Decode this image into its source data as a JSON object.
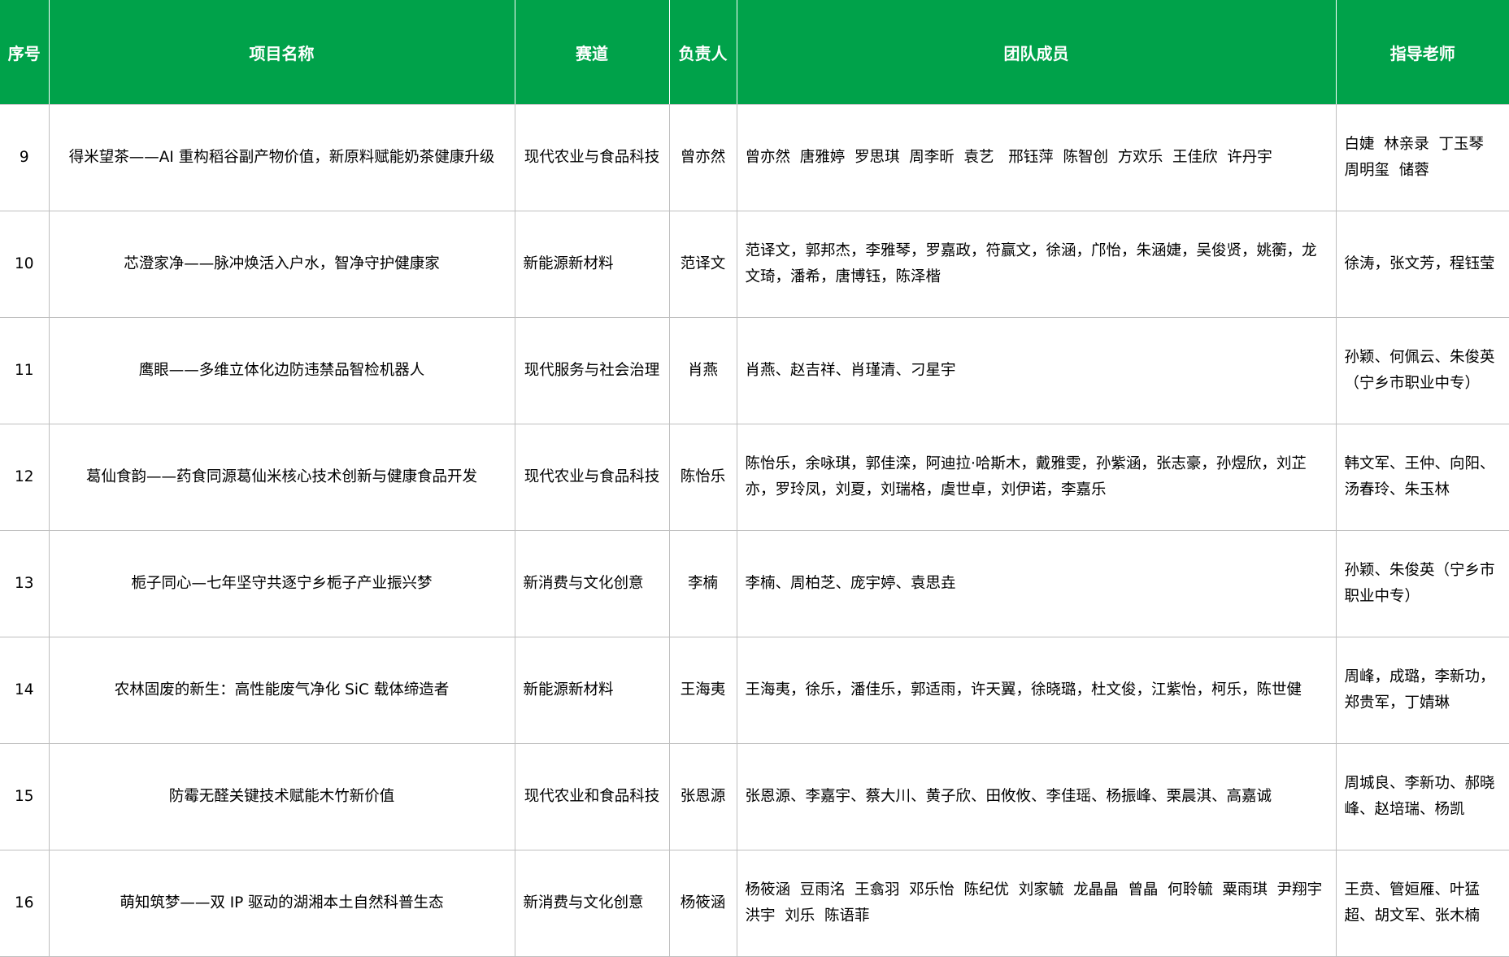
{
  "header": {
    "seq": "序号",
    "name": "项目名称",
    "track": "赛道",
    "leader": "负责人",
    "team": "团队成员",
    "advisor": "指导老师"
  },
  "rows": [
    {
      "seq": "9",
      "name": "得米望茶——AI 重构稻谷副产物价值，新原料赋能奶茶健康升级",
      "track": "现代农业与食品科技",
      "leader": "曾亦然",
      "team": "曾亦然  唐雅婷  罗思琪  周李昕  袁艺   邢钰萍  陈智创  方欢乐  王佳欣  许丹宇",
      "advisor": "白婕  林亲录  丁玉琴  周明玺  储蓉"
    },
    {
      "seq": "10",
      "name": "芯澄家净——脉冲焕活入户水，智净守护健康家",
      "track": "新能源新材料",
      "leader": "范译文",
      "team": "范译文，郭邦杰，李雅琴，罗嘉政，符赢文，徐涵，邝怡，朱涵婕，吴俊贤，姚蘅，龙文琦，潘希，唐博钰，陈泽楷",
      "advisor": "徐涛，张文芳，程钰莹"
    },
    {
      "seq": "11",
      "name": "鹰眼——多维立体化边防违禁品智检机器人",
      "track": "现代服务与社会治理",
      "leader": "肖燕",
      "team": "肖燕、赵吉祥、肖瑾清、刁星宇",
      "advisor": "孙颖、何佩云、朱俊英（宁乡市职业中专）"
    },
    {
      "seq": "12",
      "name": "葛仙食韵——药食同源葛仙米核心技术创新与健康食品开发",
      "track": "现代农业与食品科技",
      "leader": "陈怡乐",
      "team": "陈怡乐，余咏琪，郭佳滦，阿迪拉·哈斯木，戴雅雯，孙紫涵，张志豪，孙煜欣，刘芷亦，罗玲凤，刘夏，刘瑞格，虞世卓，刘伊诺，李嘉乐",
      "advisor": "韩文军、王仲、向阳、汤春玲、朱玉林"
    },
    {
      "seq": "13",
      "name": "栀子同心—七年坚守共逐宁乡栀子产业振兴梦",
      "track": "新消费与文化创意",
      "leader": "李楠",
      "team": "李楠、周柏芝、庞宇婷、袁思垚",
      "advisor": "孙颖、朱俊英（宁乡市职业中专）"
    },
    {
      "seq": "14",
      "name": "农林固废的新生：高性能废气净化 SiC 载体缔造者",
      "track": "新能源新材料",
      "leader": "王海夷",
      "team": "王海夷，徐乐，潘佳乐，郭适雨，许天翼，徐晓璐，杜文俊，江紫怡，柯乐，陈世健",
      "advisor": "周峰，成璐，李新功，郑贵军，丁婧琳"
    },
    {
      "seq": "15",
      "name": "防霉无醛关键技术赋能木竹新价值",
      "track": "现代农业和食品科技",
      "leader": "张恩源",
      "team": "张恩源、李嘉宇、蔡大川、黄子欣、田攸攸、李佳瑶、杨振峰、栗晨淇、高嘉诚",
      "advisor": "周城良、李新功、郝晓峰、赵培瑞、杨凯"
    },
    {
      "seq": "16",
      "name": "萌知筑梦——双 IP 驱动的湖湘本土自然科普生态",
      "track": "新消费与文化创意",
      "leader": "杨筱涵",
      "team": "杨筱涵  豆雨洺  王翕羽  邓乐怡  陈纪优  刘家毓  龙晶晶  曾晶  何聆毓  粟雨琪  尹翔宇  洪宇  刘乐  陈语菲",
      "advisor": "王贲、管姮雁、叶猛超、胡文军、张木楠"
    }
  ]
}
